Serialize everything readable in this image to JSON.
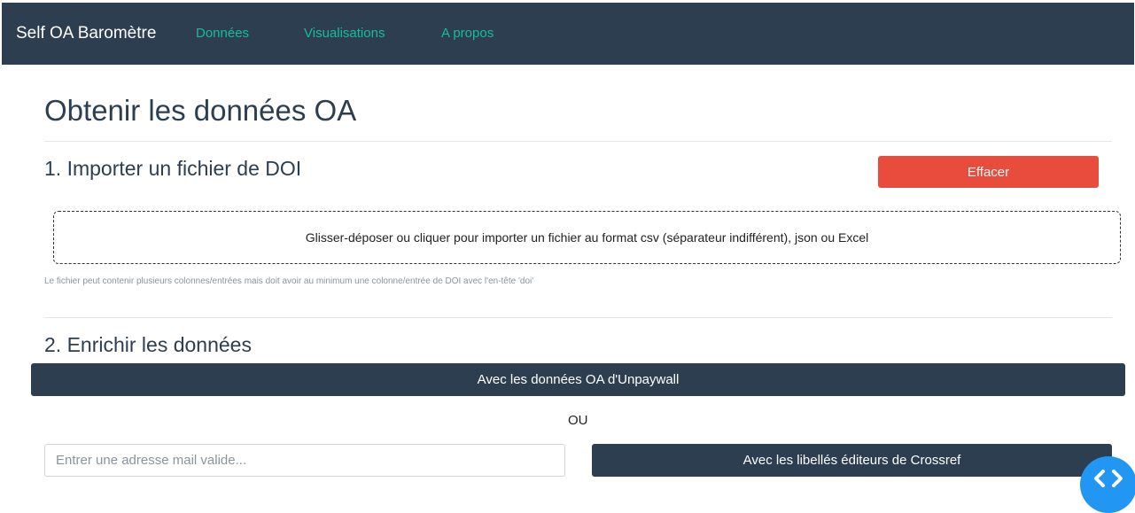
{
  "navbar": {
    "brand": "Self OA Baromètre",
    "links": [
      "Données",
      "Visualisations",
      "A propos"
    ]
  },
  "page": {
    "title": "Obtenir les données OA"
  },
  "section1": {
    "title": "1. Importer un fichier de DOI",
    "clear_button": "Effacer",
    "dropzone_text": "Glisser-déposer ou cliquer pour importer un fichier au format csv (séparateur indifférent), json ou Excel",
    "help_text": "Le fichier peut contenir plusieurs colonnes/entrées mais doit avoir au minimum une colonne/entrée de DOI avec l'en-tête 'doi'"
  },
  "section2": {
    "title": "2. Enrichir les données",
    "unpaywall_button": "Avec les données OA d'Unpaywall",
    "or_text": "OU",
    "email_placeholder": "Entrer une adresse mail valide...",
    "email_value": "",
    "crossref_button": "Avec les libellés éditeurs de Crossref"
  },
  "fab": {
    "icon": "code-icon",
    "color": "#2196f3"
  },
  "colors": {
    "navbar": "#2c3e50",
    "nav_link": "#18bc9c",
    "danger": "#e74c3c",
    "primary_dark": "#2c3e50"
  }
}
